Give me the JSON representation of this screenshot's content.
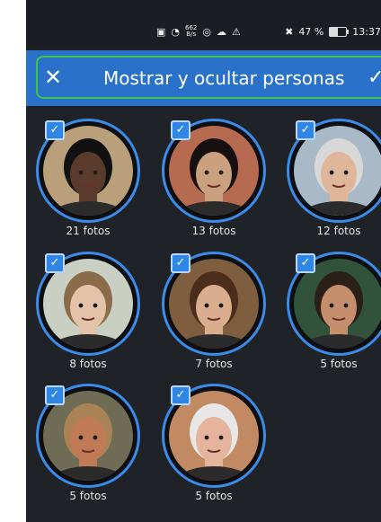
{
  "statusbar": {
    "speed_value": "662",
    "speed_unit": "B/s",
    "battery": "47 %",
    "time": "13:37",
    "icons": [
      "nfc-icon",
      "wifi-icon",
      "speed-icon",
      "instagram-icon",
      "cloud-icon",
      "warning-icon",
      "mute-icon",
      "battery-icon"
    ]
  },
  "header": {
    "title": "Mostrar y ocultar personas",
    "close_label": "✕",
    "confirm_label": "✓"
  },
  "people": [
    {
      "count": "21 fotos",
      "selected": true,
      "skin": "#5a3a2a",
      "hair": "#111111",
      "bg": "#b9a07a"
    },
    {
      "count": "13 fotos",
      "selected": true,
      "skin": "#caa07e",
      "hair": "#161010",
      "bg": "#b66a50"
    },
    {
      "count": "12 fotos",
      "selected": true,
      "skin": "#e0b69b",
      "hair": "#d8d8d8",
      "bg": "#a9b9c7"
    },
    {
      "count": "8 fotos",
      "selected": true,
      "skin": "#e2c3aa",
      "hair": "#8a6c4a",
      "bg": "#c9cfc2"
    },
    {
      "count": "7 fotos",
      "selected": true,
      "skin": "#d9ad8d",
      "hair": "#4a2d1b",
      "bg": "#7f5e40"
    },
    {
      "count": "5 fotos",
      "selected": true,
      "skin": "#c58e6d",
      "hair": "#2a2018",
      "bg": "#31523b"
    },
    {
      "count": "5 fotos",
      "selected": true,
      "skin": "#c07a55",
      "hair": "#a98355",
      "bg": "#6f6c55"
    },
    {
      "count": "5 fotos",
      "selected": true,
      "skin": "#e6b39d",
      "hair": "#e7e7e7",
      "bg": "#c28a63"
    }
  ],
  "check_glyph": "✓"
}
